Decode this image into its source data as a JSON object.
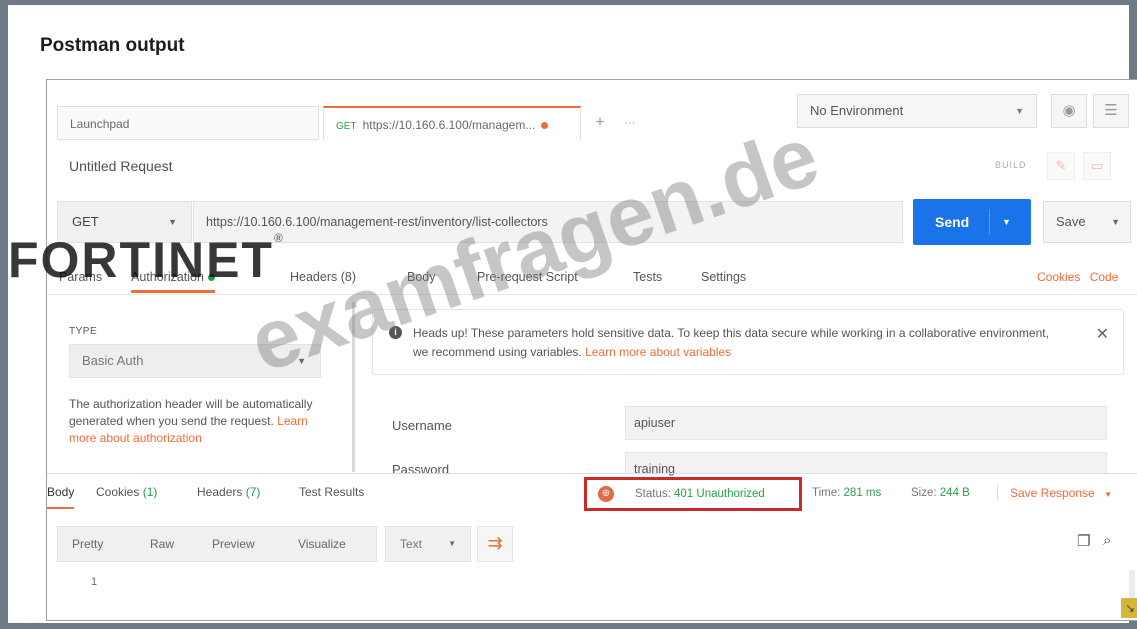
{
  "page_title": "Postman output",
  "tabs": [
    {
      "label": "Launchpad"
    },
    {
      "method": "GET",
      "label": "https://10.160.6.100/managem..."
    }
  ],
  "tab_actions": {
    "add": "+",
    "more": "···"
  },
  "environment": {
    "selected": "No Environment"
  },
  "request": {
    "name": "Untitled Request",
    "build_label": "BUILD",
    "method": "GET",
    "url": "https://10.160.6.100/management-rest/inventory/list-collectors",
    "send_label": "Send",
    "save_label": "Save"
  },
  "request_tabs": [
    "Params",
    "Authorization",
    "Headers (8)",
    "Body",
    "Pre-request Script",
    "Tests",
    "Settings"
  ],
  "request_links": {
    "cookies": "Cookies",
    "code": "Code"
  },
  "auth": {
    "type_label": "TYPE",
    "type_value": "Basic Auth",
    "description": "The authorization header will be automatically generated when you send the request. ",
    "learn_more": "Learn more about authorization"
  },
  "banner": {
    "text": "Heads up! These parameters hold sensitive data. To keep this data secure while working in a collaborative environment, we recommend using variables. ",
    "link": "Learn more about variables"
  },
  "fields": [
    {
      "label": "Username",
      "value": "apiuser"
    },
    {
      "label": "Password",
      "value": "training"
    }
  ],
  "response_tabs": {
    "body": "Body",
    "cookies": "Cookies",
    "cookies_count": "(1)",
    "headers": "Headers",
    "headers_count": "(7)",
    "test_results": "Test Results"
  },
  "response": {
    "status_label": "Status:",
    "status_value": "401 Unauthorized",
    "time_label": "Time:",
    "time_value": "281 ms",
    "size_label": "Size:",
    "size_value": "244 B",
    "save_response": "Save Response"
  },
  "view_modes": [
    "Pretty",
    "Raw",
    "Preview",
    "Visualize"
  ],
  "format": "Text",
  "body_lines": [
    "1"
  ],
  "watermarks": {
    "logo": "FORTINET",
    "text": "examfragen.de"
  },
  "colors": {
    "accent": "#f26b3a",
    "send": "#1a73e8",
    "status_ok_text": "#2b9f4a",
    "highlight_box": "#cc2a2a"
  }
}
